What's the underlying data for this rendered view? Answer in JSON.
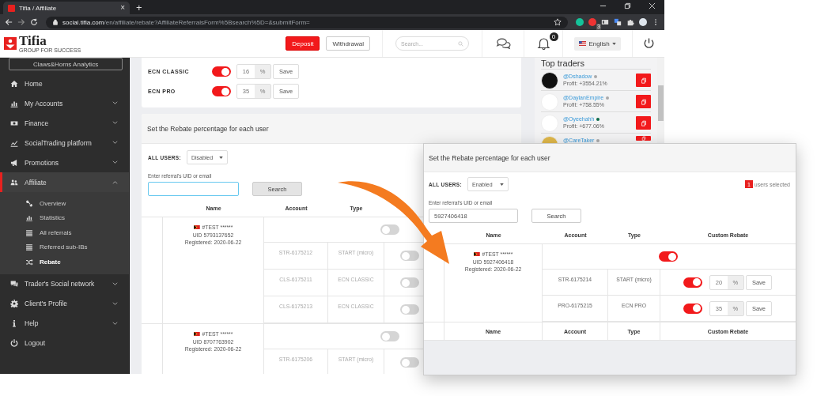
{
  "browser": {
    "tab_title": "Tifia / Affiliate",
    "tab_close": "×",
    "new_tab": "+",
    "url_host": "social.tifia.com",
    "url_path": "/en/affiliate/rebate?AffiliateReferralsForm%5Bsearch%5D=&submitForm=",
    "extension_badge": "3"
  },
  "header": {
    "brand": "Tifia",
    "tagline": "GROUP FOR SUCCESS",
    "deposit": "Deposit",
    "withdrawal": "Withdrawal",
    "search_placeholder": "Search...",
    "notifications": "0",
    "language": "English"
  },
  "sidebar": {
    "promo_button": "Claws&Horns Analytics",
    "items": [
      {
        "label": "Home",
        "selected": false
      },
      {
        "label": "My Accounts",
        "selected": false,
        "expanded": false
      },
      {
        "label": "Finance",
        "selected": false,
        "expanded": false
      },
      {
        "label": "SocialTrading platform",
        "selected": false,
        "expanded": false
      },
      {
        "label": "Promotions",
        "selected": false,
        "expanded": false
      },
      {
        "label": "Affiliate",
        "selected": true,
        "expanded": true,
        "children": [
          {
            "label": "Overview",
            "selected": false
          },
          {
            "label": "Statistics",
            "selected": false
          },
          {
            "label": "All referrals",
            "selected": false
          },
          {
            "label": "Referred sub-IBs",
            "selected": false
          },
          {
            "label": "Rebate",
            "selected": true
          }
        ]
      },
      {
        "label": "Trader's Social network",
        "selected": false,
        "expanded": false
      },
      {
        "label": "Client's Profile",
        "selected": false,
        "expanded": false
      },
      {
        "label": "Help",
        "selected": false,
        "expanded": false
      },
      {
        "label": "Logout",
        "selected": false
      }
    ]
  },
  "account_types": [
    {
      "type": "ECN CLASSIC",
      "on": true,
      "value": "16",
      "unit": "%",
      "save": "Save"
    },
    {
      "type": "ECN PRO",
      "on": true,
      "value": "35",
      "unit": "%",
      "save": "Save"
    }
  ],
  "rebate_panel": {
    "title": "Set the Rebate percentage for each user",
    "all_users_label": "ALL USERS:",
    "all_users_value": "Disabled",
    "search_label": "Enter referral's UID or email",
    "search_button": "Search",
    "columns": [
      "Name",
      "Account",
      "Type"
    ],
    "users": [
      {
        "name": "#TEST ******",
        "uid": "UID 5793137652",
        "registered": "Registered: 2020-06-22",
        "on": false,
        "accounts": [
          {
            "account": "STR-6175212",
            "type": "START (micro)",
            "on": false
          },
          {
            "account": "CLS-6175211",
            "type": "ECN CLASSIC",
            "on": false
          },
          {
            "account": "CLS-6175213",
            "type": "ECN CLASSIC",
            "on": false
          }
        ]
      },
      {
        "name": "#TEST ******",
        "uid": "UID 8707763902",
        "registered": "Registered: 2020-06-22",
        "on": false,
        "accounts": [
          {
            "account": "STR-6175206",
            "type": "START (micro)",
            "on": false
          }
        ]
      }
    ]
  },
  "top_traders": {
    "title": "Top traders",
    "traders": [
      {
        "handle": "@Dshadow",
        "profit": "Profit: +3554.21%",
        "online": false
      },
      {
        "handle": "@DaylanEmpire",
        "profit": "Profit: +758.55%",
        "online": false
      },
      {
        "handle": "@Oyeehahh",
        "profit": "Profit: +677.06%",
        "online": true
      },
      {
        "handle": "@CareTaker",
        "online": false
      }
    ]
  },
  "zoomed_panel": {
    "title": "Set the Rebate percentage for each user",
    "all_users_label": "ALL USERS:",
    "all_users_value": "Enabled",
    "selected_count": "1",
    "selected_label": "users selected",
    "search_label": "Enter referral's UID or email",
    "search_value": "5927406418",
    "search_button": "Search",
    "columns": [
      "Name",
      "Account",
      "Type",
      "Custom Rebate"
    ],
    "user": {
      "name": "#TEST ******",
      "uid": "UID 5927406418",
      "registered": "Registered: 2020-06-22",
      "on": true,
      "accounts": [
        {
          "account": "STR-6175214",
          "type": "START (micro)",
          "on": true,
          "value": "20",
          "unit": "%",
          "save": "Save"
        },
        {
          "account": "PRO-6175215",
          "type": "ECN PRO",
          "on": true,
          "value": "35",
          "unit": "%",
          "save": "Save"
        }
      ]
    },
    "footer_columns": [
      "Name",
      "Account",
      "Type",
      "Custom Rebate"
    ]
  }
}
